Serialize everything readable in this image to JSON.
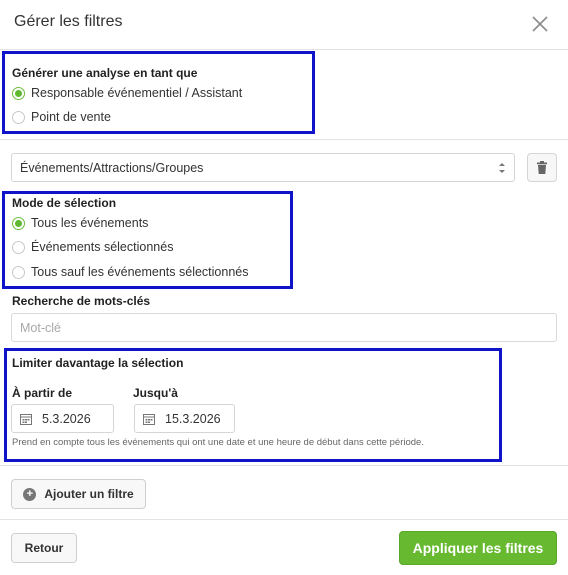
{
  "dialog": {
    "title": "Gérer les filtres"
  },
  "analysis": {
    "heading": "Générer une analyse en tant que",
    "options": [
      {
        "label": "Responsable événementiel / Assistant",
        "selected": true
      },
      {
        "label": "Point de vente",
        "selected": false
      }
    ]
  },
  "filter_type": {
    "selected_value": "Événements/Attractions/Groupes"
  },
  "selection_mode": {
    "heading": "Mode de sélection",
    "options": [
      {
        "label": "Tous les événements",
        "selected": true
      },
      {
        "label": "Événements sélectionnés",
        "selected": false
      },
      {
        "label": "Tous sauf les événements sélectionnés",
        "selected": false
      }
    ]
  },
  "keywords": {
    "heading": "Recherche de mots-clés",
    "placeholder": "Mot-clé",
    "value": ""
  },
  "limit": {
    "heading": "Limiter davantage la sélection",
    "from_label": "À partir de",
    "from_value": "5.3.2026",
    "to_label": "Jusqu'à",
    "to_value": "15.3.2026",
    "hint": "Prend en compte tous les événements qui ont une date et une heure de début dans cette période."
  },
  "actions": {
    "add_filter_label": "Ajouter un filtre",
    "back_label": "Retour",
    "apply_label": "Appliquer les filtres"
  },
  "colors": {
    "accent_green": "#67b930",
    "highlight_blue": "#1014c8"
  },
  "icons": {
    "close": "close-icon",
    "trash": "trash-icon",
    "calendar": "calendar-icon",
    "plus": "plus-circle-icon",
    "sort": "sort-arrows-icon"
  }
}
